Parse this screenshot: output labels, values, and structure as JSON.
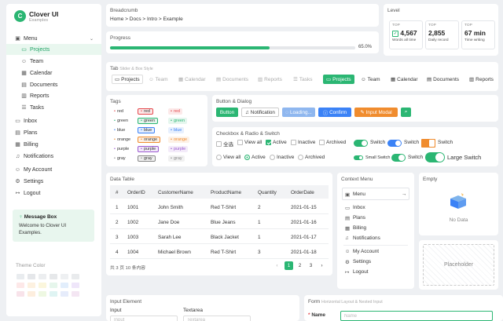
{
  "app": {
    "logo": "C",
    "title": "Clover UI",
    "subtitle": "Examples"
  },
  "sidebar": {
    "menu": {
      "label": "Menu",
      "icon": "layout-icon"
    },
    "items": [
      {
        "label": "Projects",
        "icon": "folder-icon",
        "active": true
      },
      {
        "label": "Team",
        "icon": "user-icon"
      },
      {
        "label": "Calendar",
        "icon": "calendar-icon"
      },
      {
        "label": "Documents",
        "icon": "document-icon"
      },
      {
        "label": "Reports",
        "icon": "report-icon"
      },
      {
        "label": "Tasks",
        "icon": "list-icon"
      }
    ],
    "groups": [
      {
        "label": "Inbox",
        "icon": "inbox-icon"
      },
      {
        "label": "Plans",
        "icon": "plans-icon"
      },
      {
        "label": "Billing",
        "icon": "billing-icon"
      },
      {
        "label": "Notifications",
        "icon": "bell-icon"
      }
    ],
    "account": [
      {
        "label": "My Account",
        "icon": "user-icon"
      },
      {
        "label": "Settings",
        "icon": "gear-icon"
      },
      {
        "label": "Logout",
        "icon": "logout-icon"
      }
    ],
    "message_box": {
      "title": "Message Box",
      "body": "Welcome to Clover UI Examples.",
      "icon": "bulb-icon"
    },
    "theme_color_label": "Theme Color"
  },
  "breadcrumb": {
    "title": "Breadcrumb",
    "items": [
      "Home",
      "Docs",
      "Intro",
      "Example"
    ],
    "separator": ">"
  },
  "progress": {
    "title": "Progress",
    "value": 65,
    "label": "65.0%"
  },
  "level": {
    "title": "Level",
    "stats": [
      {
        "key": "TOP",
        "value": "4,567",
        "desc": "Words all time"
      },
      {
        "key": "TOP",
        "value": "2,855",
        "desc": "Daily record"
      },
      {
        "key": "TOP",
        "value": "67 min",
        "desc": "Time writing"
      }
    ]
  },
  "tabs": {
    "title": "Tab",
    "subtitle": "Slider & Box Style",
    "items": [
      "Projects",
      "Team",
      "Calendar",
      "Documents",
      "Reports",
      "Tasks"
    ],
    "icons": [
      "folder-icon",
      "user-icon",
      "calendar-icon",
      "document-icon",
      "report-icon",
      "list-icon"
    ]
  },
  "tags": {
    "title": "Tags",
    "rows": [
      [
        "red",
        "red",
        "red"
      ],
      [
        "green",
        "green",
        "green"
      ],
      [
        "blue",
        "blue",
        "blue"
      ],
      [
        "orange",
        "orange",
        "orange"
      ],
      [
        "purple",
        "purple",
        "purple"
      ],
      [
        "gray",
        "gray",
        "gray"
      ]
    ],
    "colors": {
      "red": "#e5484d",
      "green": "#2bb673",
      "blue": "#3b82f6",
      "orange": "#f08c2e",
      "purple": "#9b59d0",
      "gray": "#888888"
    }
  },
  "buttons": {
    "title": "Button & Dialog",
    "items": [
      "Button",
      "Notification",
      "Loading...",
      "Confirm",
      "Input Modal"
    ],
    "search_icon": "search-icon"
  },
  "checkbox": {
    "title": "Checkbox & Radio & Switch",
    "checkboxes": [
      {
        "label": "全选",
        "checked": false
      },
      {
        "label": "View all",
        "checked": false
      },
      {
        "label": "Active",
        "checked": true
      },
      {
        "label": "Inactive",
        "checked": false
      },
      {
        "label": "Archived",
        "checked": false
      }
    ],
    "radios": [
      {
        "label": "View all",
        "checked": false
      },
      {
        "label": "Active",
        "checked": true
      },
      {
        "label": "Inactive",
        "checked": false
      },
      {
        "label": "Archived",
        "checked": false
      }
    ],
    "switch_label": "Switch",
    "small_switch": "Small Switch",
    "large_switch": "Large Switch"
  },
  "table": {
    "title": "Data Table",
    "columns": [
      "#",
      "OrderID",
      "CustomerName",
      "ProductName",
      "Quantity",
      "OrderDate"
    ],
    "rows": [
      [
        "1",
        "1001",
        "John Smith",
        "Red T-Shirt",
        "2",
        "2021-01-15"
      ],
      [
        "2",
        "1002",
        "Jane Doe",
        "Blue Jeans",
        "1",
        "2021-01-16"
      ],
      [
        "3",
        "1003",
        "Sarah Lee",
        "Black Jacket",
        "1",
        "2021-01-17"
      ],
      [
        "4",
        "1004",
        "Michael Brown",
        "Red T-Shirt",
        "3",
        "2021-01-18"
      ]
    ],
    "summary": "共 3 页 10 条内容",
    "pages": [
      "‹",
      "1",
      "2",
      "3",
      "›"
    ],
    "current_page": "1"
  },
  "context": {
    "title": "Context Menu",
    "menu": "Menu",
    "items": [
      "Inbox",
      "Plans",
      "Billing",
      "Notifications"
    ],
    "account": [
      "My Account",
      "Settings",
      "Logout"
    ]
  },
  "empty": {
    "title": "Empty",
    "text": "No Data"
  },
  "placeholder": {
    "text": "Placeholder"
  },
  "input": {
    "title": "Input Element",
    "input_label": "Input",
    "textarea_label": "Textarea",
    "input_placeholder": "Input",
    "textarea_placeholder": "Textarea"
  },
  "form": {
    "title": "Form",
    "subtitle": "Horizontal Layout & Nested Input",
    "name_label": "Name",
    "name_placeholder": "Name"
  }
}
